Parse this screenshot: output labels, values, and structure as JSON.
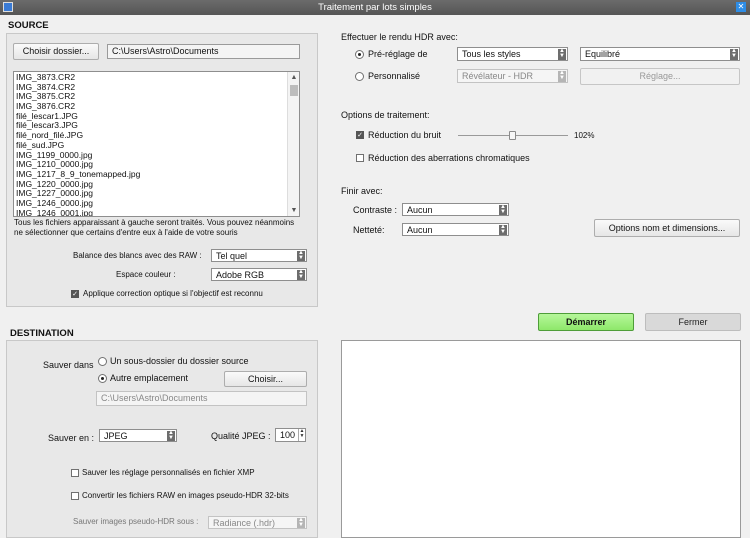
{
  "window": {
    "title": "Traitement par lots simples"
  },
  "source": {
    "heading": "SOURCE",
    "choose_folder_label": "Choisir dossier...",
    "folder_path": "C:\\Users\\Astro\\Documents",
    "files": [
      "IMG_3873.CR2",
      "IMG_3874.CR2",
      "IMG_3875.CR2",
      "IMG_3876.CR2",
      "filé_lescar1.JPG",
      "filé_lescar3.JPG",
      "filé_nord_filé.JPG",
      "filé_sud.JPG",
      "IMG_1199_0000.jpg",
      "IMG_1210_0000.jpg",
      "IMG_1217_8_9_tonemapped.jpg",
      "IMG_1220_0000.jpg",
      "IMG_1227_0000.jpg",
      "IMG_1246_0000.jpg",
      "IMG_1246_0001.jpg"
    ],
    "note_line1": "Tous les fichiers apparaissant à gauche seront traités. Vous pouvez néanmoins",
    "note_line2": "ne sélectionner que certains d'entre eux à l'aide de votre souris",
    "white_balance_label": "Balance des blancs avec des RAW :",
    "white_balance_value": "Tel quel",
    "color_space_label": "Espace couleur :",
    "color_space_value": "Adobe RGB",
    "optical_correction_label": "Applique correction optique si l'objectif est reconnu",
    "optical_correction_checked": true
  },
  "hdr": {
    "heading": "Effectuer le rendu HDR avec:",
    "preset_label": "Pré-réglage de",
    "preset_selected": true,
    "preset_style": "Tous les styles",
    "preset_value": "Equilibré",
    "custom_label": "Personnalisé",
    "custom_value": "Révélateur - HDR",
    "settings_button": "Réglage..."
  },
  "processing": {
    "heading": "Options de traitement:",
    "noise_label": "Réduction du bruit",
    "noise_checked": true,
    "noise_value": "102%",
    "noise_level": 0.5,
    "chromatic_label": "Réduction des aberrations chromatiques",
    "chromatic_checked": false
  },
  "finish": {
    "heading": "Finir avec:",
    "contrast_label": "Contraste :",
    "contrast_value": "Aucun",
    "sharpness_label": "Netteté:",
    "sharpness_value": "Aucun",
    "name_options_button": "Options nom et dimensions..."
  },
  "actions": {
    "start_label": "Démarrer",
    "close_label": "Fermer",
    "start_color": "#9af07a"
  },
  "destination": {
    "heading": "DESTINATION",
    "save_in_label": "Sauver dans",
    "subfolder_label": "Un sous-dossier du dossier source",
    "other_location_label": "Autre emplacement",
    "other_location_selected": true,
    "choose_button": "Choisir...",
    "path": "C:\\Users\\Astro\\Documents",
    "save_as_label": "Sauver en :",
    "format_value": "JPEG",
    "quality_label": "Qualité JPEG :",
    "quality_value": "100",
    "xmp_label": "Sauver les réglage personnalisés en fichier XMP",
    "raw_label": "Convertir les fichiers RAW en images pseudo-HDR 32-bits",
    "pseudo_hdr_label": "Sauver images pseudo-HDR sous :",
    "pseudo_hdr_value": "Radiance (.hdr)"
  }
}
